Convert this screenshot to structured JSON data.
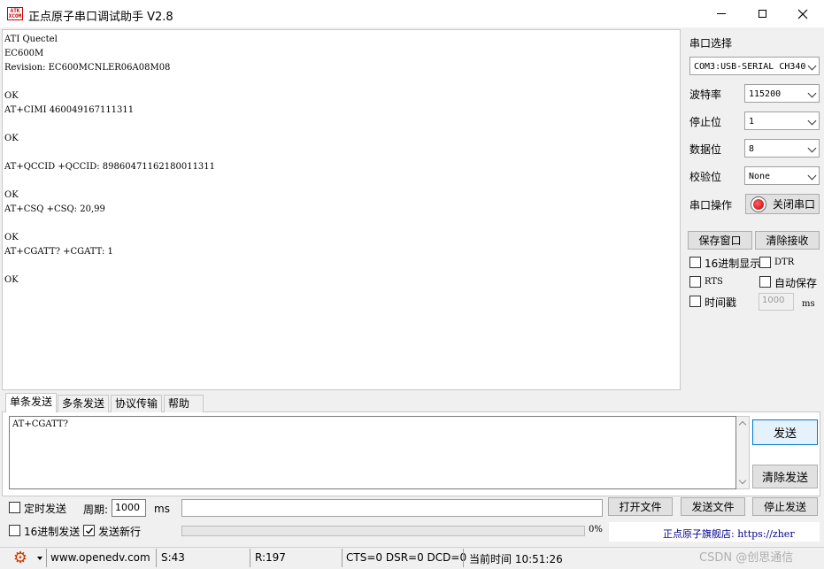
{
  "window": {
    "title": "正点原子串口调试助手 V2.8",
    "logo_text": "ATK XCOM",
    "controls": [
      "minimize-icon",
      "maximize-icon",
      "close-icon"
    ]
  },
  "receive": {
    "lines": [
      "ATI Quectel",
      "EC600M",
      "Revision: EC600MCNLER06A08M08",
      "",
      "OK",
      "AT+CIMI 460049167111311",
      "",
      "OK",
      "",
      "AT+QCCID +QCCID: 89860471162180011311",
      "",
      "OK",
      "AT+CSQ +CSQ: 20,99",
      "",
      "OK",
      "AT+CGATT? +CGATT: 1",
      "",
      "OK"
    ]
  },
  "settings": {
    "port_select_label": "串口选择",
    "port_value": "COM3:USB-SERIAL CH340",
    "baud_label": "波特率",
    "baud_value": "115200",
    "stop_label": "停止位",
    "stop_value": "1",
    "data_label": "数据位",
    "data_value": "8",
    "parity_label": "校验位",
    "parity_value": "None",
    "op_label": "串口操作",
    "op_button": "关闭串口",
    "save_window": "保存窗口",
    "clear_receive": "清除接收",
    "hex_display": "16进制显示",
    "dtr": "DTR",
    "rts": "RTS",
    "auto_save": "自动保存",
    "timestamp": "时间戳",
    "timestamp_value": "1000",
    "timestamp_unit": "ms"
  },
  "tabs": [
    "单条发送",
    "多条发送",
    "协议传输",
    "帮助"
  ],
  "send": {
    "text": "AT+CGATT?",
    "send_button": "发送",
    "clear_send_button": "清除发送",
    "timed_send": "定时发送",
    "period_label": "周期:",
    "period_value": "1000",
    "period_unit": "ms",
    "open_file": "打开文件",
    "send_file": "发送文件",
    "stop_send": "停止发送",
    "hex_send": "16进制发送",
    "send_newline": "发送新行",
    "send_newline_checked": true,
    "progress_percent": "0%",
    "store_link": "正点原子旗舰店: https://zher"
  },
  "status": {
    "website": "www.openedv.com",
    "sent": "S:43",
    "received": "R:197",
    "signals": "CTS=0 DSR=0 DCD=0",
    "time": "当前时间 10:51:26",
    "watermark": "CSDN @创思通信"
  }
}
